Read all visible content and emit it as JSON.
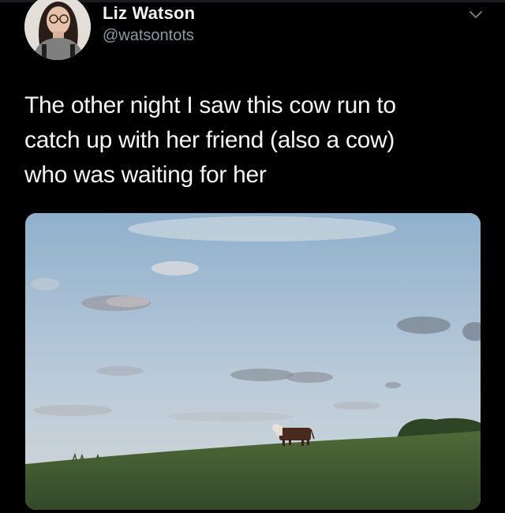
{
  "tweet": {
    "author": {
      "display_name": "Liz Watson",
      "handle": "@watsontots",
      "avatar_icon": "profile-photo"
    },
    "menu_icon": "chevron-down-icon",
    "text_lines": [
      "The other night I saw this cow run to",
      "catch up with her friend (also a cow)",
      "who was waiting for her"
    ],
    "media": {
      "type": "video-still",
      "subject": "cow-running-on-hill"
    }
  },
  "colors": {
    "background": "#000000",
    "text_primary": "#f5f5f5",
    "text_secondary": "#8b98a5",
    "sky": "#a9c0d6",
    "grass": "#3f5a2c"
  }
}
